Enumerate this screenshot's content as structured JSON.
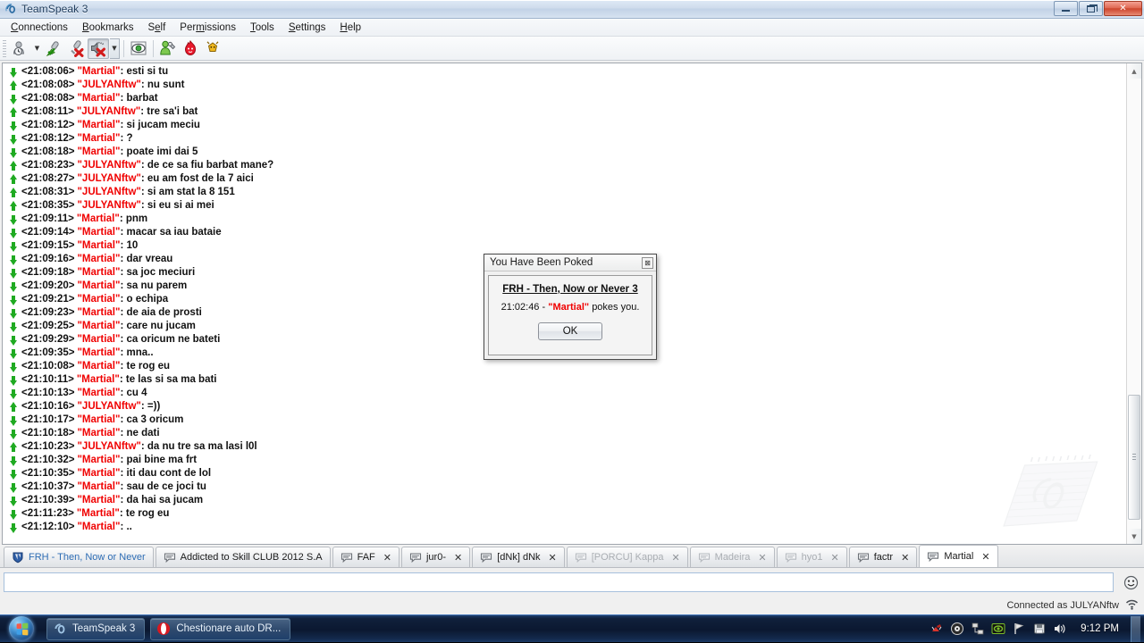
{
  "window": {
    "title": "TeamSpeak 3",
    "app_icon": "teamspeak-logo-icon",
    "controls": {
      "minimize": "minimize-button",
      "restore": "restore-button",
      "close": "✕"
    }
  },
  "menubar": {
    "items": [
      {
        "label": "Connections",
        "mnemonic": "C"
      },
      {
        "label": "Bookmarks",
        "mnemonic": "B"
      },
      {
        "label": "Self",
        "mnemonic": "e"
      },
      {
        "label": "Permissions",
        "mnemonic": "m"
      },
      {
        "label": "Tools",
        "mnemonic": "T"
      },
      {
        "label": "Settings",
        "mnemonic": "S"
      },
      {
        "label": "Help",
        "mnemonic": "H"
      }
    ]
  },
  "toolbar": {
    "buttons": [
      {
        "name": "connect-icon",
        "pressed": false,
        "dropdown": true
      },
      {
        "name": "microphone-enabled-icon",
        "pressed": false,
        "dropdown": false
      },
      {
        "name": "microphone-muted-icon",
        "pressed": false,
        "dropdown": false
      },
      {
        "name": "speaker-muted-icon",
        "pressed": true,
        "dropdown": true
      },
      {
        "name": "away-status-icon",
        "pressed": false,
        "dropdown": false
      },
      {
        "name": "user-settings-icon",
        "pressed": false,
        "dropdown": false
      },
      {
        "name": "flame-icon",
        "pressed": false,
        "dropdown": false
      },
      {
        "name": "plugin-bug-icon",
        "pressed": false,
        "dropdown": false
      }
    ]
  },
  "chat": {
    "messages": [
      {
        "dir": "down",
        "time": "<21:08:06>",
        "nick": "\"Martial\"",
        "text": "esti si tu"
      },
      {
        "dir": "up",
        "time": "<21:08:08>",
        "nick": "\"JULYANftw\"",
        "text": "nu sunt"
      },
      {
        "dir": "down",
        "time": "<21:08:08>",
        "nick": "\"Martial\"",
        "text": "barbat"
      },
      {
        "dir": "up",
        "time": "<21:08:11>",
        "nick": "\"JULYANftw\"",
        "text": "tre sa'i bat"
      },
      {
        "dir": "down",
        "time": "<21:08:12>",
        "nick": "\"Martial\"",
        "text": "si jucam meciu"
      },
      {
        "dir": "down",
        "time": "<21:08:12>",
        "nick": "\"Martial\"",
        "text": "?"
      },
      {
        "dir": "down",
        "time": "<21:08:18>",
        "nick": "\"Martial\"",
        "text": "poate imi dai 5"
      },
      {
        "dir": "up",
        "time": "<21:08:23>",
        "nick": "\"JULYANftw\"",
        "text": "de ce sa fiu barbat mane?"
      },
      {
        "dir": "up",
        "time": "<21:08:27>",
        "nick": "\"JULYANftw\"",
        "text": "eu am fost de la 7 aici"
      },
      {
        "dir": "up",
        "time": "<21:08:31>",
        "nick": "\"JULYANftw\"",
        "text": "si am stat la 8 151"
      },
      {
        "dir": "up",
        "time": "<21:08:35>",
        "nick": "\"JULYANftw\"",
        "text": "si eu si ai mei"
      },
      {
        "dir": "down",
        "time": "<21:09:11>",
        "nick": "\"Martial\"",
        "text": "pnm"
      },
      {
        "dir": "down",
        "time": "<21:09:14>",
        "nick": "\"Martial\"",
        "text": "macar sa iau bataie"
      },
      {
        "dir": "down",
        "time": "<21:09:15>",
        "nick": "\"Martial\"",
        "text": "10"
      },
      {
        "dir": "down",
        "time": "<21:09:16>",
        "nick": "\"Martial\"",
        "text": "dar vreau"
      },
      {
        "dir": "down",
        "time": "<21:09:18>",
        "nick": "\"Martial\"",
        "text": "sa joc meciuri"
      },
      {
        "dir": "down",
        "time": "<21:09:20>",
        "nick": "\"Martial\"",
        "text": "sa nu parem"
      },
      {
        "dir": "down",
        "time": "<21:09:21>",
        "nick": "\"Martial\"",
        "text": "o echipa"
      },
      {
        "dir": "down",
        "time": "<21:09:23>",
        "nick": "\"Martial\"",
        "text": "de aia de prosti"
      },
      {
        "dir": "down",
        "time": "<21:09:25>",
        "nick": "\"Martial\"",
        "text": "care nu jucam"
      },
      {
        "dir": "down",
        "time": "<21:09:29>",
        "nick": "\"Martial\"",
        "text": "ca oricum ne bateti"
      },
      {
        "dir": "down",
        "time": "<21:09:35>",
        "nick": "\"Martial\"",
        "text": "mna.."
      },
      {
        "dir": "down",
        "time": "<21:10:08>",
        "nick": "\"Martial\"",
        "text": "te rog eu"
      },
      {
        "dir": "down",
        "time": "<21:10:11>",
        "nick": "\"Martial\"",
        "text": "te las si sa ma bati"
      },
      {
        "dir": "down",
        "time": "<21:10:13>",
        "nick": "\"Martial\"",
        "text": "cu 4"
      },
      {
        "dir": "up",
        "time": "<21:10:16>",
        "nick": "\"JULYANftw\"",
        "text": "=))"
      },
      {
        "dir": "down",
        "time": "<21:10:17>",
        "nick": "\"Martial\"",
        "text": "ca 3 oricum"
      },
      {
        "dir": "down",
        "time": "<21:10:18>",
        "nick": "\"Martial\"",
        "text": "ne dati"
      },
      {
        "dir": "up",
        "time": "<21:10:23>",
        "nick": "\"JULYANftw\"",
        "text": "da nu tre sa ma lasi l0l"
      },
      {
        "dir": "down",
        "time": "<21:10:32>",
        "nick": "\"Martial\"",
        "text": "pai bine ma frt"
      },
      {
        "dir": "down",
        "time": "<21:10:35>",
        "nick": "\"Martial\"",
        "text": "iti dau cont de lol"
      },
      {
        "dir": "down",
        "time": "<21:10:37>",
        "nick": "\"Martial\"",
        "text": "sau de ce joci tu"
      },
      {
        "dir": "down",
        "time": "<21:10:39>",
        "nick": "\"Martial\"",
        "text": "da hai sa jucam"
      },
      {
        "dir": "down",
        "time": "<21:11:23>",
        "nick": "\"Martial\"",
        "text": "te rog eu"
      },
      {
        "dir": "down",
        "time": "<21:12:10>",
        "nick": "\"Martial\"",
        "text": ".."
      }
    ],
    "colors": {
      "nick": "#f00000",
      "text": "#111111",
      "arrow": "#1faa21"
    }
  },
  "poke_dialog": {
    "title": "You Have Been Poked",
    "close_glyph": "⊠",
    "server": "FRH - Then, Now or Never 3",
    "time": "21:02:46",
    "separator": "-",
    "nick": "\"Martial\"",
    "message_suffix": "pokes you.",
    "ok_label": "OK"
  },
  "tabs": [
    {
      "label": "FRH - Then, Now or Never",
      "icon": "server-shield-icon",
      "kind": "server",
      "closable": false,
      "active": false,
      "dim": false
    },
    {
      "label": "Addicted to Skill CLUB 2012 S.A",
      "icon": "channel-chat-icon",
      "kind": "chat",
      "closable": false,
      "active": false,
      "dim": false
    },
    {
      "label": "FAF",
      "icon": "private-chat-icon",
      "kind": "chat",
      "closable": true,
      "active": false,
      "dim": false
    },
    {
      "label": "jur0-",
      "icon": "private-chat-icon",
      "kind": "chat",
      "closable": true,
      "active": false,
      "dim": false
    },
    {
      "label": "[dNk] dNk",
      "icon": "private-chat-icon",
      "kind": "chat",
      "closable": true,
      "active": false,
      "dim": false
    },
    {
      "label": "[PORCU] Kappa",
      "icon": "private-chat-icon",
      "kind": "chat",
      "closable": true,
      "active": false,
      "dim": true
    },
    {
      "label": "Madeira",
      "icon": "private-chat-icon",
      "kind": "chat",
      "closable": true,
      "active": false,
      "dim": true
    },
    {
      "label": "hyo1",
      "icon": "private-chat-icon",
      "kind": "chat",
      "closable": true,
      "active": false,
      "dim": true
    },
    {
      "label": "factr",
      "icon": "private-chat-icon",
      "kind": "chat",
      "closable": true,
      "active": false,
      "dim": false
    },
    {
      "label": "Martial",
      "icon": "private-chat-icon",
      "kind": "chat",
      "closable": true,
      "active": true,
      "dim": false
    }
  ],
  "input": {
    "value": "",
    "placeholder": "",
    "smiley_icon": "smiley-icon"
  },
  "status": {
    "connected_text": "Connected as JULYANftw",
    "signal_icon": "signal-strength-icon"
  },
  "taskbar": {
    "start_icon": "windows-start-orb-icon",
    "buttons": [
      {
        "label": "TeamSpeak 3",
        "icon": "teamspeak-taskbar-icon"
      },
      {
        "label": "Chestionare auto DR...",
        "icon": "opera-browser-icon"
      }
    ],
    "tray_icons": [
      "antivirus-icon",
      "media-player-icon",
      "network-connections-icon",
      "nvidia-settings-icon",
      "flag-action-center-icon",
      "safely-remove-icon",
      "volume-icon"
    ],
    "clock": "9:12 PM"
  }
}
